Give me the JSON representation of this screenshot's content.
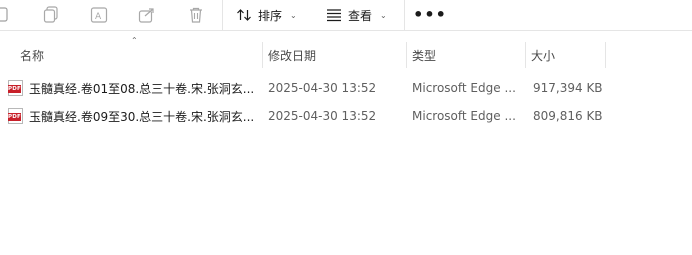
{
  "toolbar": {
    "sort_label": "排序",
    "view_label": "查看",
    "more_label": "•••"
  },
  "columns": {
    "name": "名称",
    "modified": "修改日期",
    "type": "类型",
    "size": "大小"
  },
  "files": [
    {
      "icon_label": "PDF",
      "name": "玉髓真经.卷01至08.总三十卷.宋.张洞玄...",
      "modified": "2025-04-30 13:52",
      "type": "Microsoft Edge ...",
      "size": "917,394 KB"
    },
    {
      "icon_label": "PDF",
      "name": "玉髓真经.卷09至30.总三十卷.宋.张洞玄...",
      "modified": "2025-04-30 13:52",
      "type": "Microsoft Edge ...",
      "size": "809,816 KB"
    }
  ]
}
